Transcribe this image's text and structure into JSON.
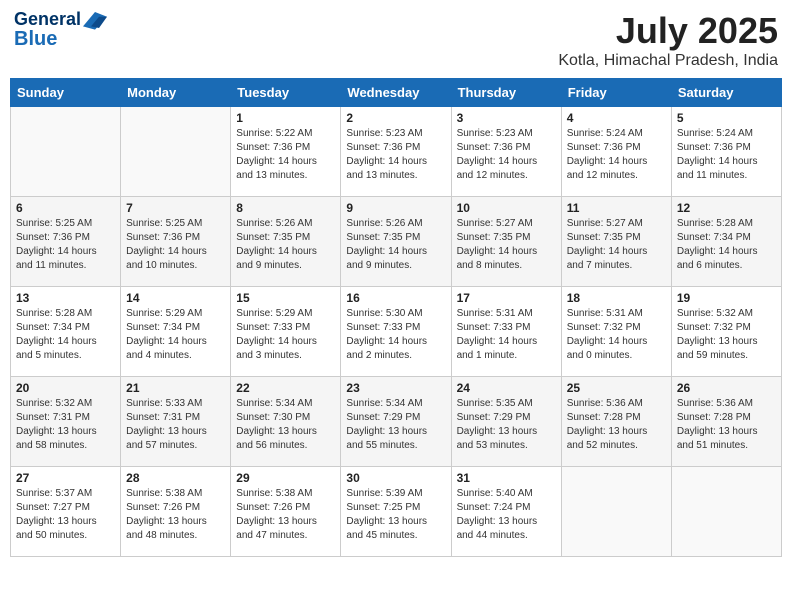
{
  "header": {
    "logo_line1": "General",
    "logo_line2": "Blue",
    "month": "July 2025",
    "location": "Kotla, Himachal Pradesh, India"
  },
  "weekdays": [
    "Sunday",
    "Monday",
    "Tuesday",
    "Wednesday",
    "Thursday",
    "Friday",
    "Saturday"
  ],
  "weeks": [
    [
      {
        "day": "",
        "info": ""
      },
      {
        "day": "",
        "info": ""
      },
      {
        "day": "1",
        "info": "Sunrise: 5:22 AM\nSunset: 7:36 PM\nDaylight: 14 hours\nand 13 minutes."
      },
      {
        "day": "2",
        "info": "Sunrise: 5:23 AM\nSunset: 7:36 PM\nDaylight: 14 hours\nand 13 minutes."
      },
      {
        "day": "3",
        "info": "Sunrise: 5:23 AM\nSunset: 7:36 PM\nDaylight: 14 hours\nand 12 minutes."
      },
      {
        "day": "4",
        "info": "Sunrise: 5:24 AM\nSunset: 7:36 PM\nDaylight: 14 hours\nand 12 minutes."
      },
      {
        "day": "5",
        "info": "Sunrise: 5:24 AM\nSunset: 7:36 PM\nDaylight: 14 hours\nand 11 minutes."
      }
    ],
    [
      {
        "day": "6",
        "info": "Sunrise: 5:25 AM\nSunset: 7:36 PM\nDaylight: 14 hours\nand 11 minutes."
      },
      {
        "day": "7",
        "info": "Sunrise: 5:25 AM\nSunset: 7:36 PM\nDaylight: 14 hours\nand 10 minutes."
      },
      {
        "day": "8",
        "info": "Sunrise: 5:26 AM\nSunset: 7:35 PM\nDaylight: 14 hours\nand 9 minutes."
      },
      {
        "day": "9",
        "info": "Sunrise: 5:26 AM\nSunset: 7:35 PM\nDaylight: 14 hours\nand 9 minutes."
      },
      {
        "day": "10",
        "info": "Sunrise: 5:27 AM\nSunset: 7:35 PM\nDaylight: 14 hours\nand 8 minutes."
      },
      {
        "day": "11",
        "info": "Sunrise: 5:27 AM\nSunset: 7:35 PM\nDaylight: 14 hours\nand 7 minutes."
      },
      {
        "day": "12",
        "info": "Sunrise: 5:28 AM\nSunset: 7:34 PM\nDaylight: 14 hours\nand 6 minutes."
      }
    ],
    [
      {
        "day": "13",
        "info": "Sunrise: 5:28 AM\nSunset: 7:34 PM\nDaylight: 14 hours\nand 5 minutes."
      },
      {
        "day": "14",
        "info": "Sunrise: 5:29 AM\nSunset: 7:34 PM\nDaylight: 14 hours\nand 4 minutes."
      },
      {
        "day": "15",
        "info": "Sunrise: 5:29 AM\nSunset: 7:33 PM\nDaylight: 14 hours\nand 3 minutes."
      },
      {
        "day": "16",
        "info": "Sunrise: 5:30 AM\nSunset: 7:33 PM\nDaylight: 14 hours\nand 2 minutes."
      },
      {
        "day": "17",
        "info": "Sunrise: 5:31 AM\nSunset: 7:33 PM\nDaylight: 14 hours\nand 1 minute."
      },
      {
        "day": "18",
        "info": "Sunrise: 5:31 AM\nSunset: 7:32 PM\nDaylight: 14 hours\nand 0 minutes."
      },
      {
        "day": "19",
        "info": "Sunrise: 5:32 AM\nSunset: 7:32 PM\nDaylight: 13 hours\nand 59 minutes."
      }
    ],
    [
      {
        "day": "20",
        "info": "Sunrise: 5:32 AM\nSunset: 7:31 PM\nDaylight: 13 hours\nand 58 minutes."
      },
      {
        "day": "21",
        "info": "Sunrise: 5:33 AM\nSunset: 7:31 PM\nDaylight: 13 hours\nand 57 minutes."
      },
      {
        "day": "22",
        "info": "Sunrise: 5:34 AM\nSunset: 7:30 PM\nDaylight: 13 hours\nand 56 minutes."
      },
      {
        "day": "23",
        "info": "Sunrise: 5:34 AM\nSunset: 7:29 PM\nDaylight: 13 hours\nand 55 minutes."
      },
      {
        "day": "24",
        "info": "Sunrise: 5:35 AM\nSunset: 7:29 PM\nDaylight: 13 hours\nand 53 minutes."
      },
      {
        "day": "25",
        "info": "Sunrise: 5:36 AM\nSunset: 7:28 PM\nDaylight: 13 hours\nand 52 minutes."
      },
      {
        "day": "26",
        "info": "Sunrise: 5:36 AM\nSunset: 7:28 PM\nDaylight: 13 hours\nand 51 minutes."
      }
    ],
    [
      {
        "day": "27",
        "info": "Sunrise: 5:37 AM\nSunset: 7:27 PM\nDaylight: 13 hours\nand 50 minutes."
      },
      {
        "day": "28",
        "info": "Sunrise: 5:38 AM\nSunset: 7:26 PM\nDaylight: 13 hours\nand 48 minutes."
      },
      {
        "day": "29",
        "info": "Sunrise: 5:38 AM\nSunset: 7:26 PM\nDaylight: 13 hours\nand 47 minutes."
      },
      {
        "day": "30",
        "info": "Sunrise: 5:39 AM\nSunset: 7:25 PM\nDaylight: 13 hours\nand 45 minutes."
      },
      {
        "day": "31",
        "info": "Sunrise: 5:40 AM\nSunset: 7:24 PM\nDaylight: 13 hours\nand 44 minutes."
      },
      {
        "day": "",
        "info": ""
      },
      {
        "day": "",
        "info": ""
      }
    ]
  ]
}
